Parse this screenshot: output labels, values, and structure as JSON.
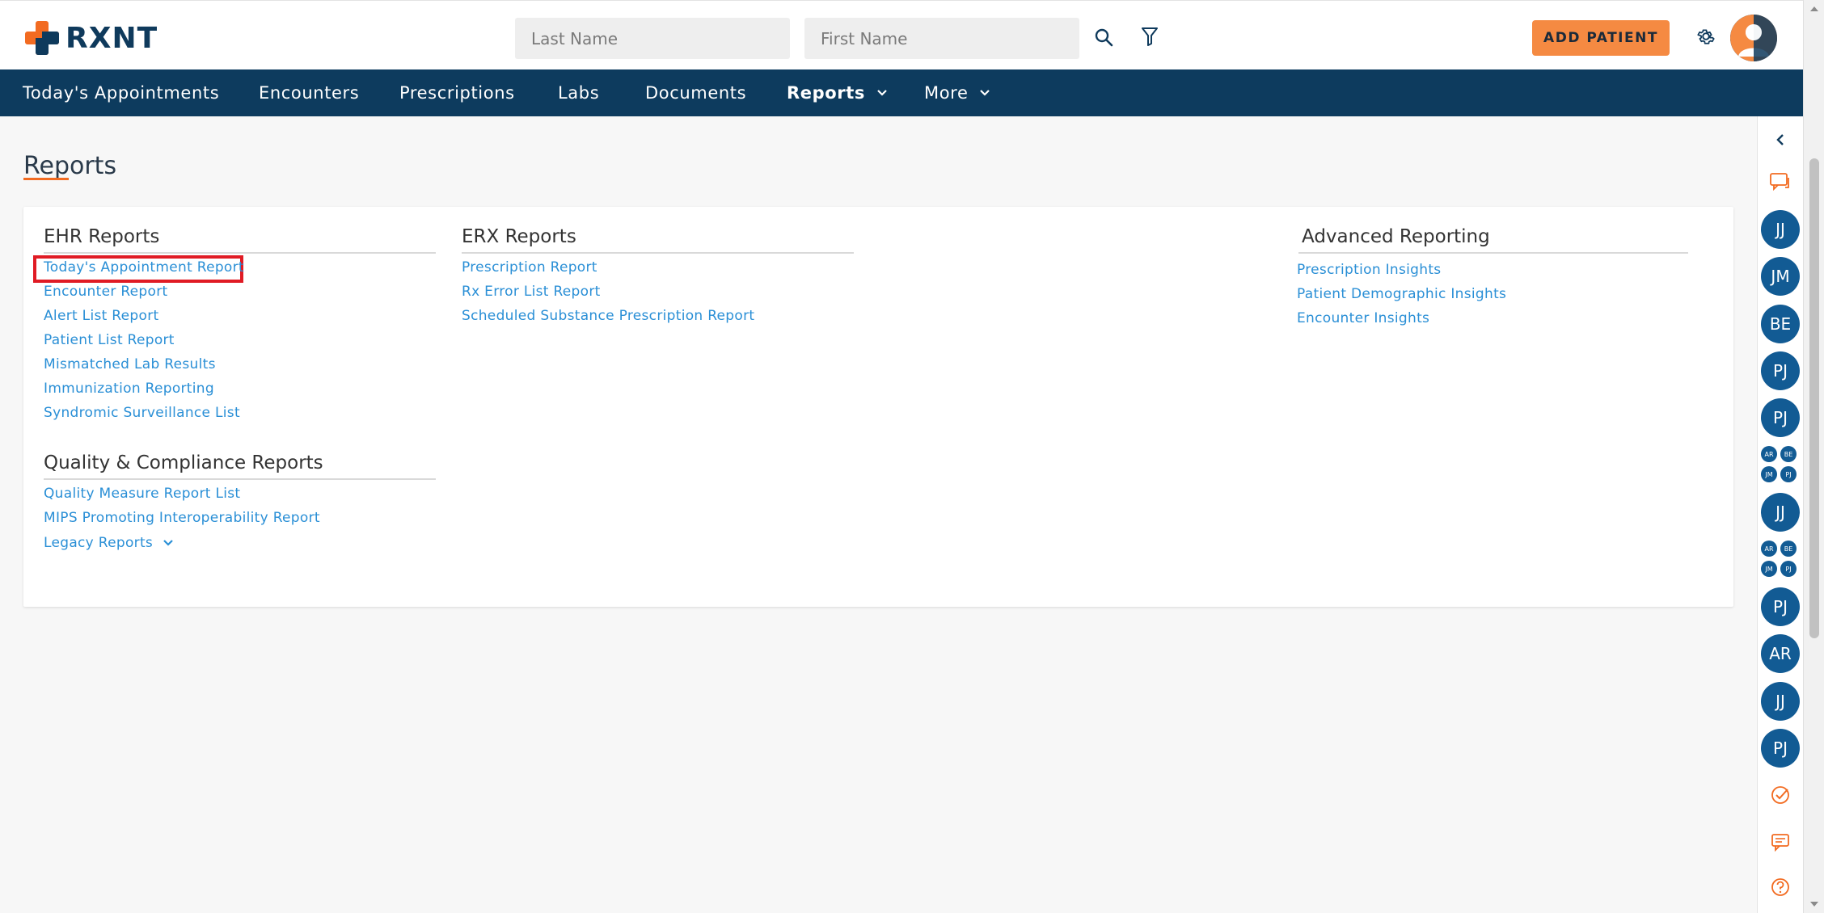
{
  "header": {
    "logo_text": "RXNT",
    "last_name_placeholder": "Last Name",
    "first_name_placeholder": "First Name",
    "add_patient_label": "ADD PATIENT"
  },
  "nav": {
    "items": [
      {
        "label": "Today's Appointments"
      },
      {
        "label": "Encounters"
      },
      {
        "label": "Prescriptions"
      },
      {
        "label": "Labs"
      },
      {
        "label": "Documents"
      },
      {
        "label": "Reports"
      },
      {
        "label": "More"
      }
    ]
  },
  "page": {
    "title": "Reports"
  },
  "sections": {
    "ehr": {
      "heading": "EHR Reports",
      "links": [
        "Today's Appointment Report",
        "Encounter Report",
        "Alert List Report",
        "Patient List Report",
        "Mismatched Lab Results",
        "Immunization Reporting",
        "Syndromic Surveillance List"
      ]
    },
    "quality": {
      "heading": "Quality & Compliance Reports",
      "links": [
        "Quality Measure Report List",
        "MIPS Promoting Interoperability Report",
        "Legacy Reports"
      ]
    },
    "erx": {
      "heading": "ERX Reports",
      "links": [
        "Prescription Report",
        "Rx Error List Report",
        "Scheduled Substance Prescription Report"
      ]
    },
    "advanced": {
      "heading": "Advanced Reporting",
      "links": [
        "Prescription Insights",
        "Patient Demographic Insights",
        "Encounter Insights"
      ]
    }
  },
  "right_rail": {
    "avatars": [
      "JJ",
      "JM",
      "BE",
      "PJ",
      "PJ",
      "JJ",
      "PJ",
      "AR",
      "JJ",
      "PJ"
    ],
    "group1": [
      "AR",
      "BE",
      "JM",
      "PJ"
    ],
    "group2": [
      "AR",
      "BE",
      "JM",
      "PJ"
    ]
  },
  "colors": {
    "nav_bg": "#0d3b5e",
    "accent_orange": "#f26b21",
    "link_blue": "#2a8fd6",
    "avatar_blue": "#125b94",
    "highlight_red": "#e01b24"
  }
}
